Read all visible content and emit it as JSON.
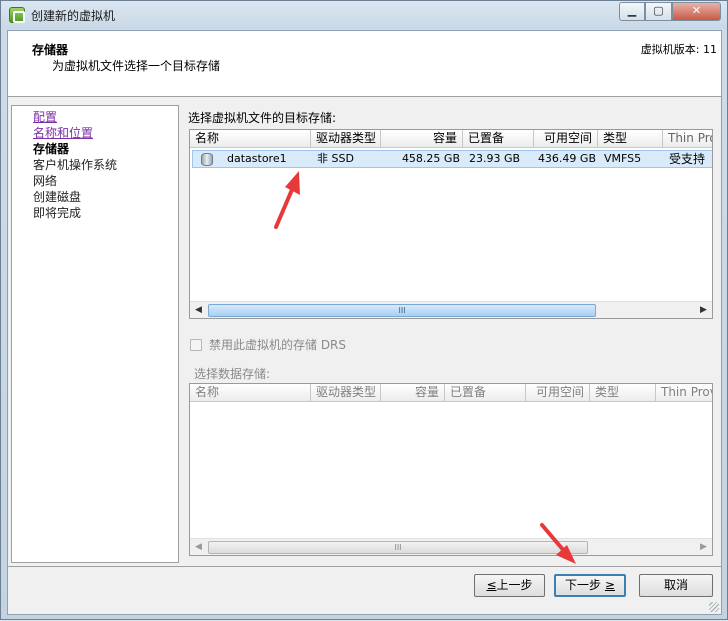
{
  "window": {
    "title": "创建新的虚拟机",
    "controls": {
      "minimize": "▁",
      "maximize": "▢",
      "close": "✕"
    }
  },
  "header": {
    "title": "存储器",
    "subtitle": "为虚拟机文件选择一个目标存储",
    "version": "虚拟机版本: 11"
  },
  "nav": {
    "items": [
      {
        "label": "配置",
        "state": "link"
      },
      {
        "label": "名称和位置",
        "state": "link"
      },
      {
        "label": "存储器",
        "state": "current"
      },
      {
        "label": "客户机操作系统",
        "state": "pending"
      },
      {
        "label": "网络",
        "state": "pending"
      },
      {
        "label": "创建磁盘",
        "state": "pending"
      },
      {
        "label": "即将完成",
        "state": "pending"
      }
    ]
  },
  "main": {
    "label": "选择虚拟机文件的目标存储:",
    "columns": [
      "名称",
      "驱动器类型",
      "容量",
      "已置备",
      "可用空间",
      "类型",
      "Thin Provi"
    ],
    "rows": [
      {
        "name": "datastore1",
        "drive": "非 SSD",
        "capacity": "458.25 GB",
        "provisioned": "23.93 GB",
        "free": "436.49 GB",
        "type": "VMFS5",
        "thin": "受支持"
      }
    ],
    "scroll_thumb": "III",
    "scroll_left": "◀",
    "scroll_right": "▶"
  },
  "drs": {
    "label": "禁用此虚拟机的存储 DRS",
    "checked": false
  },
  "secondary": {
    "label": "选择数据存储:",
    "columns": [
      "名称",
      "驱动器类型",
      "容量",
      "已置备",
      "可用空间",
      "类型",
      "Thin Provi"
    ],
    "scroll_thumb": "III"
  },
  "footer": {
    "back": "上一步",
    "back_key": "≤",
    "next": "下一步",
    "next_key": "≥",
    "cancel": "取消"
  },
  "colors": {
    "annotation_arrow": "#e8393a",
    "selection": "#d9ebfb",
    "link": "#7b2fa8"
  }
}
